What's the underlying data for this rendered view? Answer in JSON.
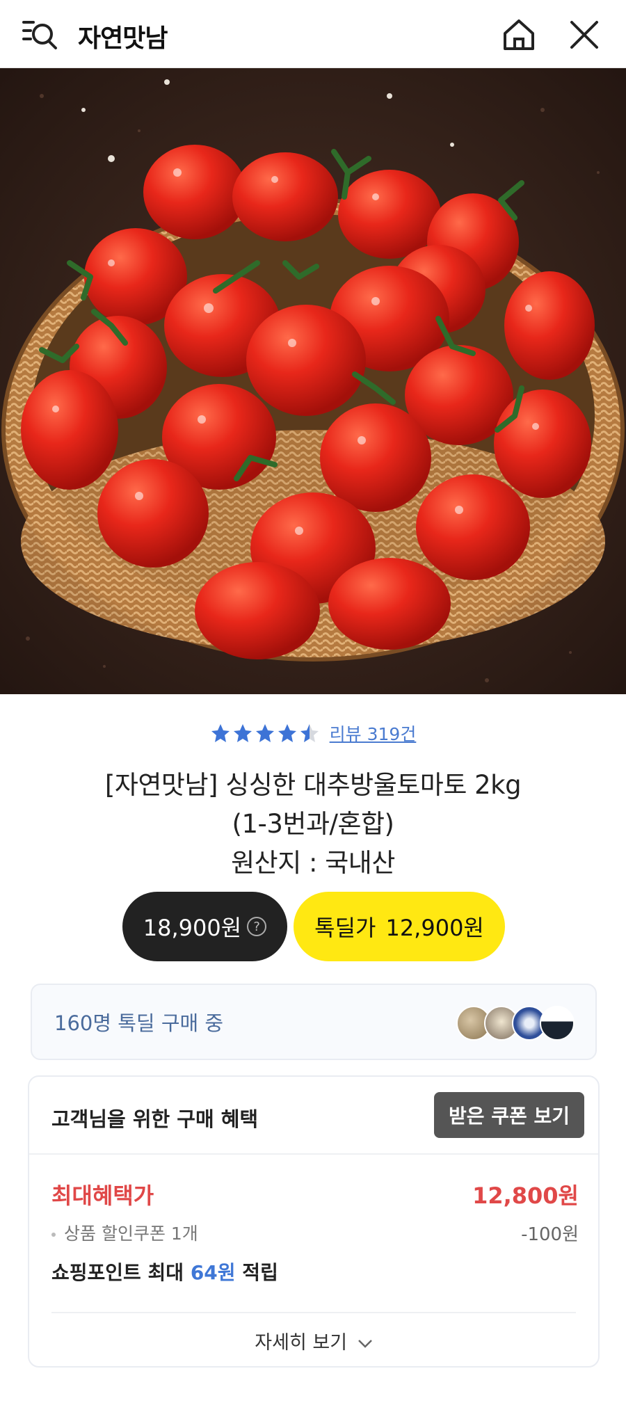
{
  "header": {
    "store_name": "자연맛남",
    "icons": [
      "menu-search-icon",
      "home-icon",
      "close-icon"
    ]
  },
  "product": {
    "image": "cherry-tomatoes-in-wicker-basket",
    "rating_value": 4.5,
    "review_label": "리뷰 319건",
    "title_line1": "[자연맛남] 싱싱한 대추방울토마토 2kg",
    "title_line2": "(1-3번과/혼합)",
    "title_line3": "원산지 : 국내산"
  },
  "prices": {
    "original": "18,900원",
    "question_mark": "?",
    "deal_label": "톡딜가",
    "deal_price": "12,900원"
  },
  "buyers": {
    "text": "160명 톡딜 구매 중"
  },
  "benefit": {
    "heading": "고객님을 위한 구매 혜택",
    "coupon_button": "받은 쿠폰 보기",
    "max_label": "최대혜택가",
    "max_value": "12,800원",
    "coupon_line": "상품 할인쿠폰 1개",
    "coupon_amount": "-100원",
    "point_prefix": "쇼핑포인트 최대 ",
    "point_value": "64원",
    "point_suffix": " 적립",
    "more_label": "자세히 보기"
  },
  "colors": {
    "deal_yellow": "#ffe812",
    "price_dark": "#222222",
    "accent_red": "#e04848",
    "accent_blue": "#3f77d6",
    "star_blue": "#3d73d6"
  }
}
